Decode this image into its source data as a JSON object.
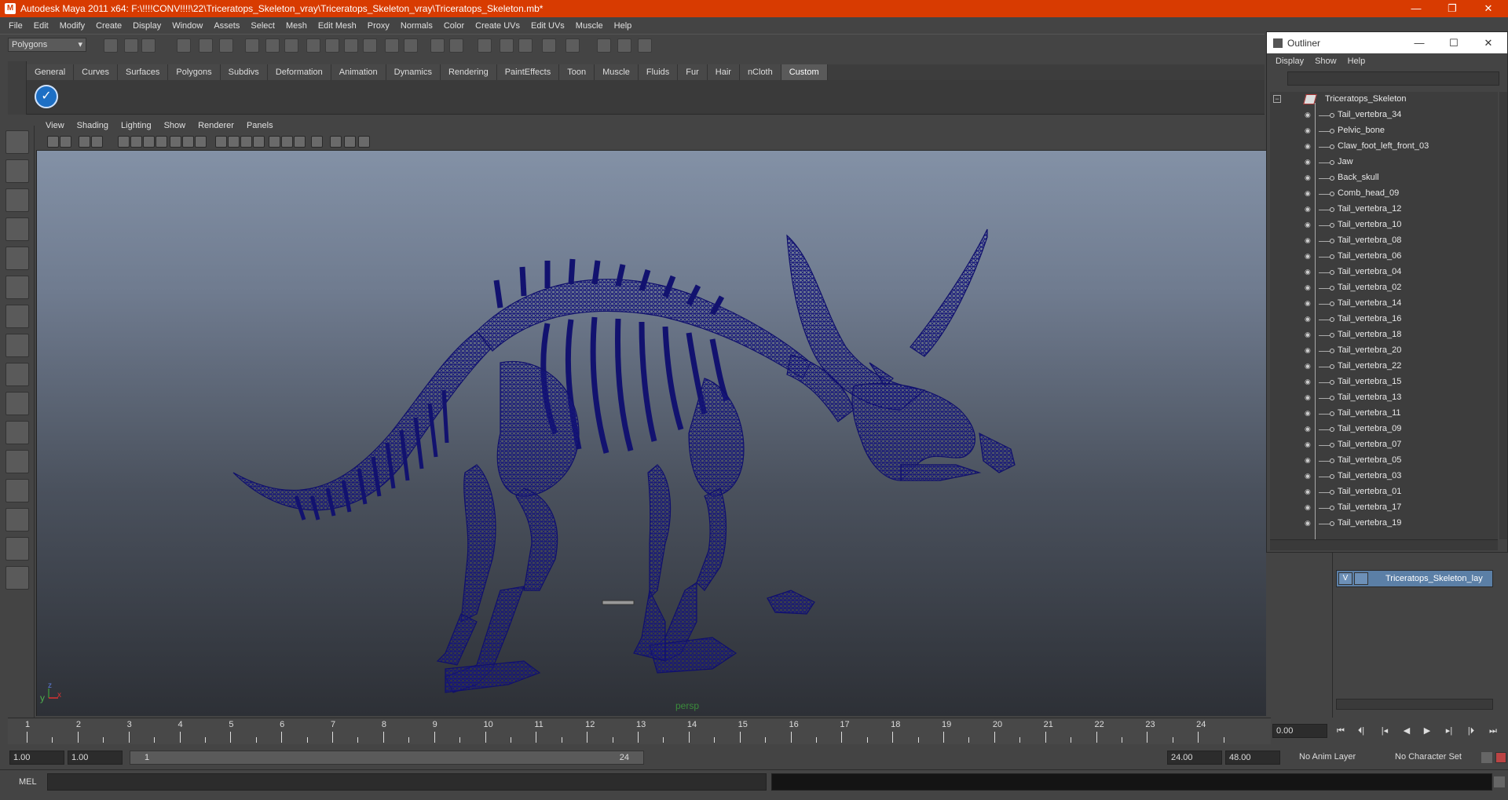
{
  "window": {
    "title": "Autodesk Maya 2011 x64: F:\\!!!!CONV!!!!\\22\\Triceratops_Skeleton_vray\\Triceratops_Skeleton_vray\\Triceratops_Skeleton.mb*",
    "minimize": "—",
    "restore": "❐",
    "close": "✕"
  },
  "menubar": [
    "File",
    "Edit",
    "Modify",
    "Create",
    "Display",
    "Window",
    "Assets",
    "Select",
    "Mesh",
    "Edit Mesh",
    "Proxy",
    "Normals",
    "Color",
    "Create UVs",
    "Edit UVs",
    "Muscle",
    "Help"
  ],
  "statusline": {
    "mode": "Polygons"
  },
  "shelf": {
    "tabs": [
      "General",
      "Curves",
      "Surfaces",
      "Polygons",
      "Subdivs",
      "Deformation",
      "Animation",
      "Dynamics",
      "Rendering",
      "PaintEffects",
      "Toon",
      "Muscle",
      "Fluids",
      "Fur",
      "Hair",
      "nCloth",
      "Custom"
    ],
    "active_tab": "Custom"
  },
  "viewport": {
    "menu": [
      "View",
      "Shading",
      "Lighting",
      "Show",
      "Renderer",
      "Panels"
    ],
    "camera_label": "persp",
    "axis_x": "x",
    "axis_y": "y",
    "axis_z": "z",
    "wire_color": "#1a1a7a"
  },
  "outliner": {
    "title": "Outliner",
    "menu": [
      "Display",
      "Show",
      "Help"
    ],
    "root": "Triceratops_Skeleton",
    "items": [
      "Tail_vertebra_34",
      "Pelvic_bone",
      "Claw_foot_left_front_03",
      "Jaw",
      "Back_skull",
      "Comb_head_09",
      "Tail_vertebra_12",
      "Tail_vertebra_10",
      "Tail_vertebra_08",
      "Tail_vertebra_06",
      "Tail_vertebra_04",
      "Tail_vertebra_02",
      "Tail_vertebra_14",
      "Tail_vertebra_16",
      "Tail_vertebra_18",
      "Tail_vertebra_20",
      "Tail_vertebra_22",
      "Tail_vertebra_15",
      "Tail_vertebra_13",
      "Tail_vertebra_11",
      "Tail_vertebra_09",
      "Tail_vertebra_07",
      "Tail_vertebra_05",
      "Tail_vertebra_03",
      "Tail_vertebra_01",
      "Tail_vertebra_17",
      "Tail_vertebra_19"
    ]
  },
  "layers": {
    "visible": "V",
    "name": "Triceratops_Skeleton_lay"
  },
  "timeline": {
    "ticks": [
      "1",
      "2",
      "3",
      "4",
      "5",
      "6",
      "7",
      "8",
      "9",
      "10",
      "11",
      "12",
      "13",
      "14",
      "15",
      "16",
      "17",
      "18",
      "19",
      "20",
      "21",
      "22",
      "23",
      "24"
    ],
    "current_time": "0.00"
  },
  "range": {
    "start_time": "1.00",
    "playback_start": "1.00",
    "slider_start": "1",
    "slider_end": "24",
    "playback_end": "24.00",
    "end_time": "48.00",
    "anim_layer": "No Anim Layer",
    "character_set": "No Character Set"
  },
  "command": {
    "label": "MEL"
  }
}
